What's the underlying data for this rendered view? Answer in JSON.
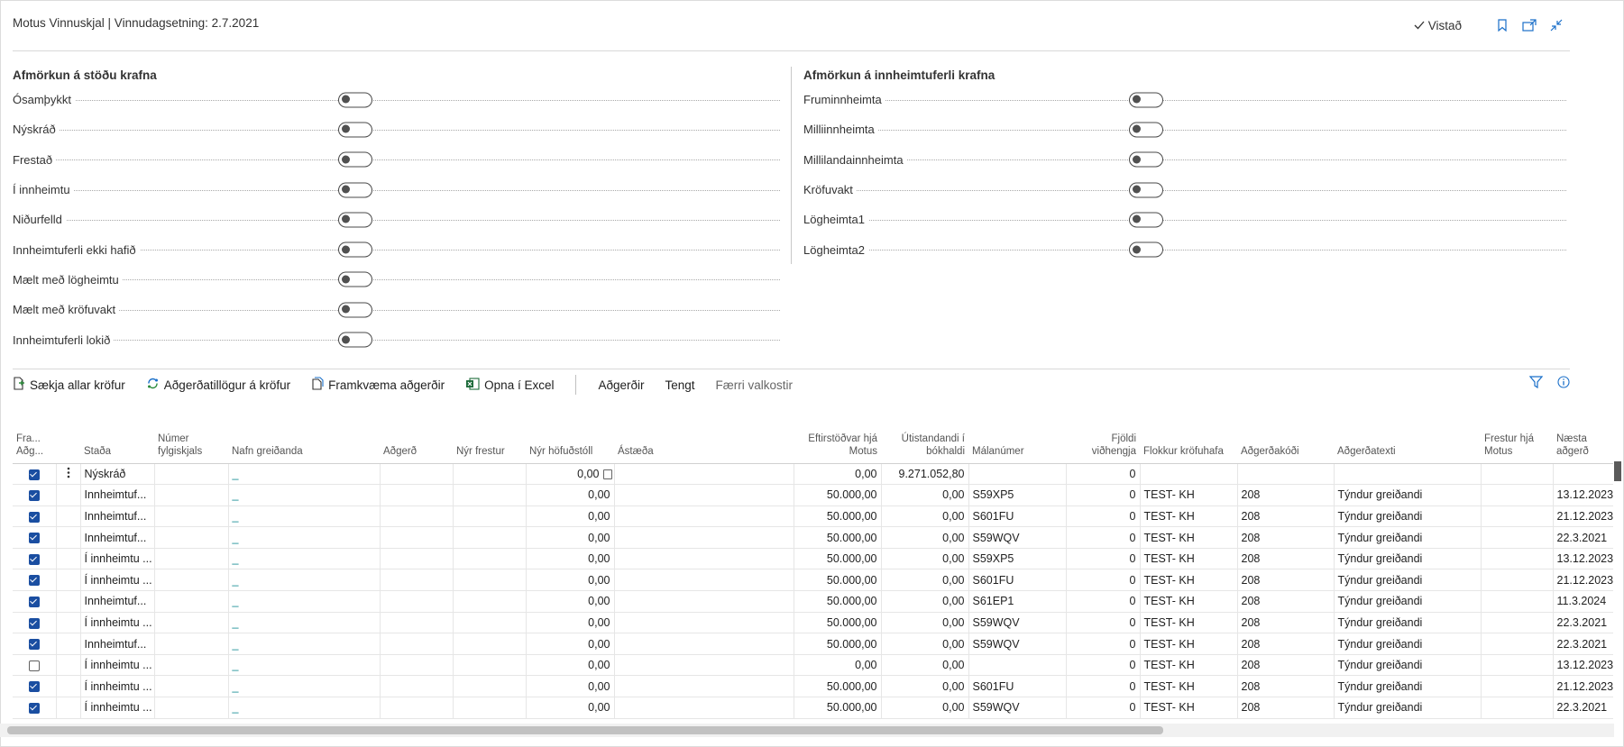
{
  "header": {
    "title": "Motus Vinnuskjal | Vinnudagsetning: 2.7.2021",
    "saved_label": "Vistað"
  },
  "filters": {
    "left": {
      "title": "Afmörkun á stöðu krafna",
      "items": [
        {
          "label": "Ósamþykkt",
          "on": false
        },
        {
          "label": "Nýskráð",
          "on": false
        },
        {
          "label": "Frestað",
          "on": false
        },
        {
          "label": "Í innheimtu",
          "on": false
        },
        {
          "label": "Niðurfelld",
          "on": false
        },
        {
          "label": "Innheimtuferli ekki hafið",
          "on": false
        },
        {
          "label": "Mælt með lögheimtu",
          "on": false
        },
        {
          "label": "Mælt með kröfuvakt",
          "on": false
        },
        {
          "label": "Innheimtuferli lokið",
          "on": false
        }
      ]
    },
    "right": {
      "title": "Afmörkun á innheimtuferli krafna",
      "items": [
        {
          "label": "Fruminnheimta",
          "on": false
        },
        {
          "label": "Milliinnheimta",
          "on": false
        },
        {
          "label": "Millilandainnheimta",
          "on": false
        },
        {
          "label": "Kröfuvakt",
          "on": false
        },
        {
          "label": "Lögheimta1",
          "on": false
        },
        {
          "label": "Lögheimta2",
          "on": false
        }
      ]
    }
  },
  "toolbar": {
    "fetch_all": "Sækja allar kröfur",
    "suggestions": "Aðgerðatillögur á kröfur",
    "execute": "Framkvæma aðgerðir",
    "open_excel": "Opna í Excel",
    "actions": "Aðgerðir",
    "related": "Tengt",
    "fewer_options": "Færri valkostir"
  },
  "table": {
    "headers": {
      "fram": "Fra... Aðg...",
      "stada": "Staða",
      "numer": "Númer fylgiskjals",
      "nafn": "Nafn greiðanda",
      "adgerd": "Aðgerð",
      "frestur": "Nýr frestur",
      "hofudstoll": "Nýr höfuðstóll",
      "astaeda": "Ástæða",
      "eftirstodvar": "Eftirstöðvar hjá Motus",
      "utistandandi": "Útistandandi í bókhaldi",
      "malanumer": "Málanúmer",
      "fjoldi": "Fjöldi viðhengja",
      "flokkur": "Flokkur kröfuhafa",
      "adgerdakodi": "Aðgerðakóði",
      "adgerdatexti": "Aðgerðatexti",
      "frestur_motus": "Frestur hjá Motus",
      "naesta": "Næsta aðgerð"
    },
    "rows": [
      {
        "checked": true,
        "stada": "Nýskráð",
        "nafn": "_",
        "hofudstoll": "0,00",
        "eftirstodvar": "0,00",
        "utistandandi": "9.271.052,80",
        "malanumer": "",
        "fjoldi": "0",
        "flokkur": "",
        "kodi": "",
        "texti": "",
        "naesta": ""
      },
      {
        "checked": true,
        "stada": "Innheimtuf...",
        "nafn": "_",
        "hofudstoll": "0,00",
        "eftirstodvar": "50.000,00",
        "utistandandi": "0,00",
        "malanumer": "S59XP5",
        "fjoldi": "0",
        "flokkur": "TEST- KH",
        "kodi": "208",
        "texti": "Týndur greiðandi",
        "naesta": "13.12.2023"
      },
      {
        "checked": true,
        "stada": "Innheimtuf...",
        "nafn": "_",
        "hofudstoll": "0,00",
        "eftirstodvar": "50.000,00",
        "utistandandi": "0,00",
        "malanumer": "S601FU",
        "fjoldi": "0",
        "flokkur": "TEST- KH",
        "kodi": "208",
        "texti": "Týndur greiðandi",
        "naesta": "21.12.2023"
      },
      {
        "checked": true,
        "stada": "Innheimtuf...",
        "nafn": "_",
        "hofudstoll": "0,00",
        "eftirstodvar": "50.000,00",
        "utistandandi": "0,00",
        "malanumer": "S59WQV",
        "fjoldi": "0",
        "flokkur": "TEST- KH",
        "kodi": "208",
        "texti": "Týndur greiðandi",
        "naesta": "22.3.2021"
      },
      {
        "checked": true,
        "stada": "Í innheimtu ...",
        "nafn": "_",
        "hofudstoll": "0,00",
        "eftirstodvar": "50.000,00",
        "utistandandi": "0,00",
        "malanumer": "S59XP5",
        "fjoldi": "0",
        "flokkur": "TEST- KH",
        "kodi": "208",
        "texti": "Týndur greiðandi",
        "naesta": "13.12.2023"
      },
      {
        "checked": true,
        "stada": "Í innheimtu ...",
        "nafn": "_",
        "hofudstoll": "0,00",
        "eftirstodvar": "50.000,00",
        "utistandandi": "0,00",
        "malanumer": "S601FU",
        "fjoldi": "0",
        "flokkur": "TEST- KH",
        "kodi": "208",
        "texti": "Týndur greiðandi",
        "naesta": "21.12.2023"
      },
      {
        "checked": true,
        "stada": "Innheimtuf...",
        "nafn": "_",
        "hofudstoll": "0,00",
        "eftirstodvar": "50.000,00",
        "utistandandi": "0,00",
        "malanumer": "S61EP1",
        "fjoldi": "0",
        "flokkur": "TEST- KH",
        "kodi": "208",
        "texti": "Týndur greiðandi",
        "naesta": "11.3.2024"
      },
      {
        "checked": true,
        "stada": "Í innheimtu ...",
        "nafn": "_",
        "hofudstoll": "0,00",
        "eftirstodvar": "50.000,00",
        "utistandandi": "0,00",
        "malanumer": "S59WQV",
        "fjoldi": "0",
        "flokkur": "TEST- KH",
        "kodi": "208",
        "texti": "Týndur greiðandi",
        "naesta": "22.3.2021"
      },
      {
        "checked": true,
        "stada": "Innheimtuf...",
        "nafn": "_",
        "hofudstoll": "0,00",
        "eftirstodvar": "50.000,00",
        "utistandandi": "0,00",
        "malanumer": "S59WQV",
        "fjoldi": "0",
        "flokkur": "TEST- KH",
        "kodi": "208",
        "texti": "Týndur greiðandi",
        "naesta": "22.3.2021"
      },
      {
        "checked": false,
        "stada": "Í innheimtu ...",
        "nafn": "_",
        "hofudstoll": "0,00",
        "eftirstodvar": "0,00",
        "utistandandi": "0,00",
        "malanumer": "",
        "fjoldi": "0",
        "flokkur": "TEST- KH",
        "kodi": "208",
        "texti": "Týndur greiðandi",
        "naesta": "13.12.2023"
      },
      {
        "checked": true,
        "stada": "Í innheimtu ...",
        "nafn": "_",
        "hofudstoll": "0,00",
        "eftirstodvar": "50.000,00",
        "utistandandi": "0,00",
        "malanumer": "S601FU",
        "fjoldi": "0",
        "flokkur": "TEST- KH",
        "kodi": "208",
        "texti": "Týndur greiðandi",
        "naesta": "21.12.2023"
      },
      {
        "checked": true,
        "stada": "Í innheimtu ...",
        "nafn": "_",
        "hofudstoll": "0,00",
        "eftirstodvar": "50.000,00",
        "utistandandi": "0,00",
        "malanumer": "S59WQV",
        "fjoldi": "0",
        "flokkur": "TEST- KH",
        "kodi": "208",
        "texti": "Týndur greiðandi",
        "naesta": "22.3.2021"
      }
    ]
  },
  "colors": {
    "accent": "#108a91",
    "checkbox": "#1a4ea1",
    "selected_cell": "#d5f0f1"
  },
  "icons": {
    "saved": "check-icon",
    "bookmark": "bookmark-icon",
    "share": "share-icon",
    "collapse": "collapse-icon",
    "filter": "filter-icon",
    "info": "info-icon"
  }
}
